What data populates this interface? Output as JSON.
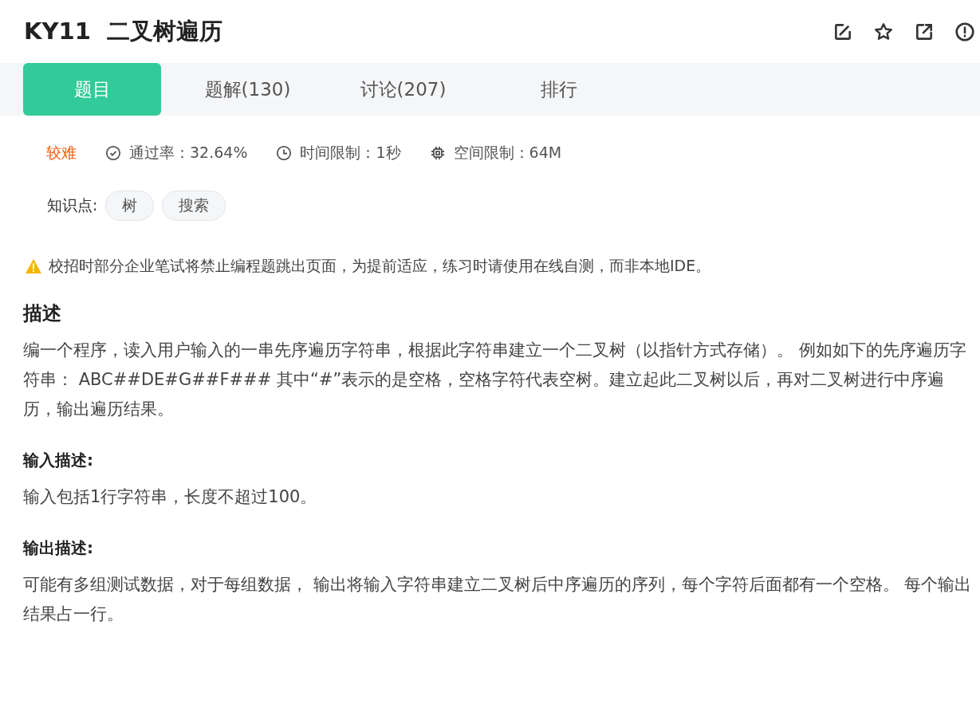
{
  "header": {
    "code": "KY11",
    "title": "二叉树遍历"
  },
  "toolbar": [
    {
      "kind": "edit"
    },
    {
      "kind": "star"
    },
    {
      "kind": "share"
    },
    {
      "kind": "report"
    }
  ],
  "tabs": [
    {
      "label": "题目",
      "selected": true
    },
    {
      "label": "题解(130)",
      "selected": false
    },
    {
      "label": "讨论(207)",
      "selected": false
    },
    {
      "label": "排行",
      "selected": false
    }
  ],
  "meta": {
    "difficulty": {
      "text": "较难",
      "color": "#f25e0f"
    },
    "items": [
      {
        "kind": "pass",
        "text": "通过率：32.64%"
      },
      {
        "kind": "time",
        "text": "时间限制：1秒"
      },
      {
        "kind": "memory",
        "text": "空间限制：64M"
      }
    ]
  },
  "knowledge": {
    "label": "知识点:",
    "tags": [
      "树",
      "搜索"
    ]
  },
  "notice": "校招时部分企业笔试将禁止编程题跳出页面，为提前适应，练习时请使用在线自测，而非本地IDE。",
  "sections": [
    {
      "kind": "main",
      "heading": "描述",
      "text": "编一个程序，读入用户输入的一串先序遍历字符串，根据此字符串建立一个二叉树（以指针方式存储）。 例如如下的先序遍历字符串： ABC##DE#G##F### 其中“#”表示的是空格，空格字符代表空树。建立起此二叉树以后，再对二叉树进行中序遍历，输出遍历结果。"
    },
    {
      "kind": "sub",
      "heading": "输入描述:",
      "text": "输入包括1行字符串，长度不超过100。"
    },
    {
      "kind": "sub",
      "heading": "输出描述:",
      "text": "可能有多组测试数据，对于每组数据， 输出将输入字符串建立二叉树后中序遍历的序列，每个字符后面都有一个空格。 每个输出结果占一行。"
    }
  ]
}
